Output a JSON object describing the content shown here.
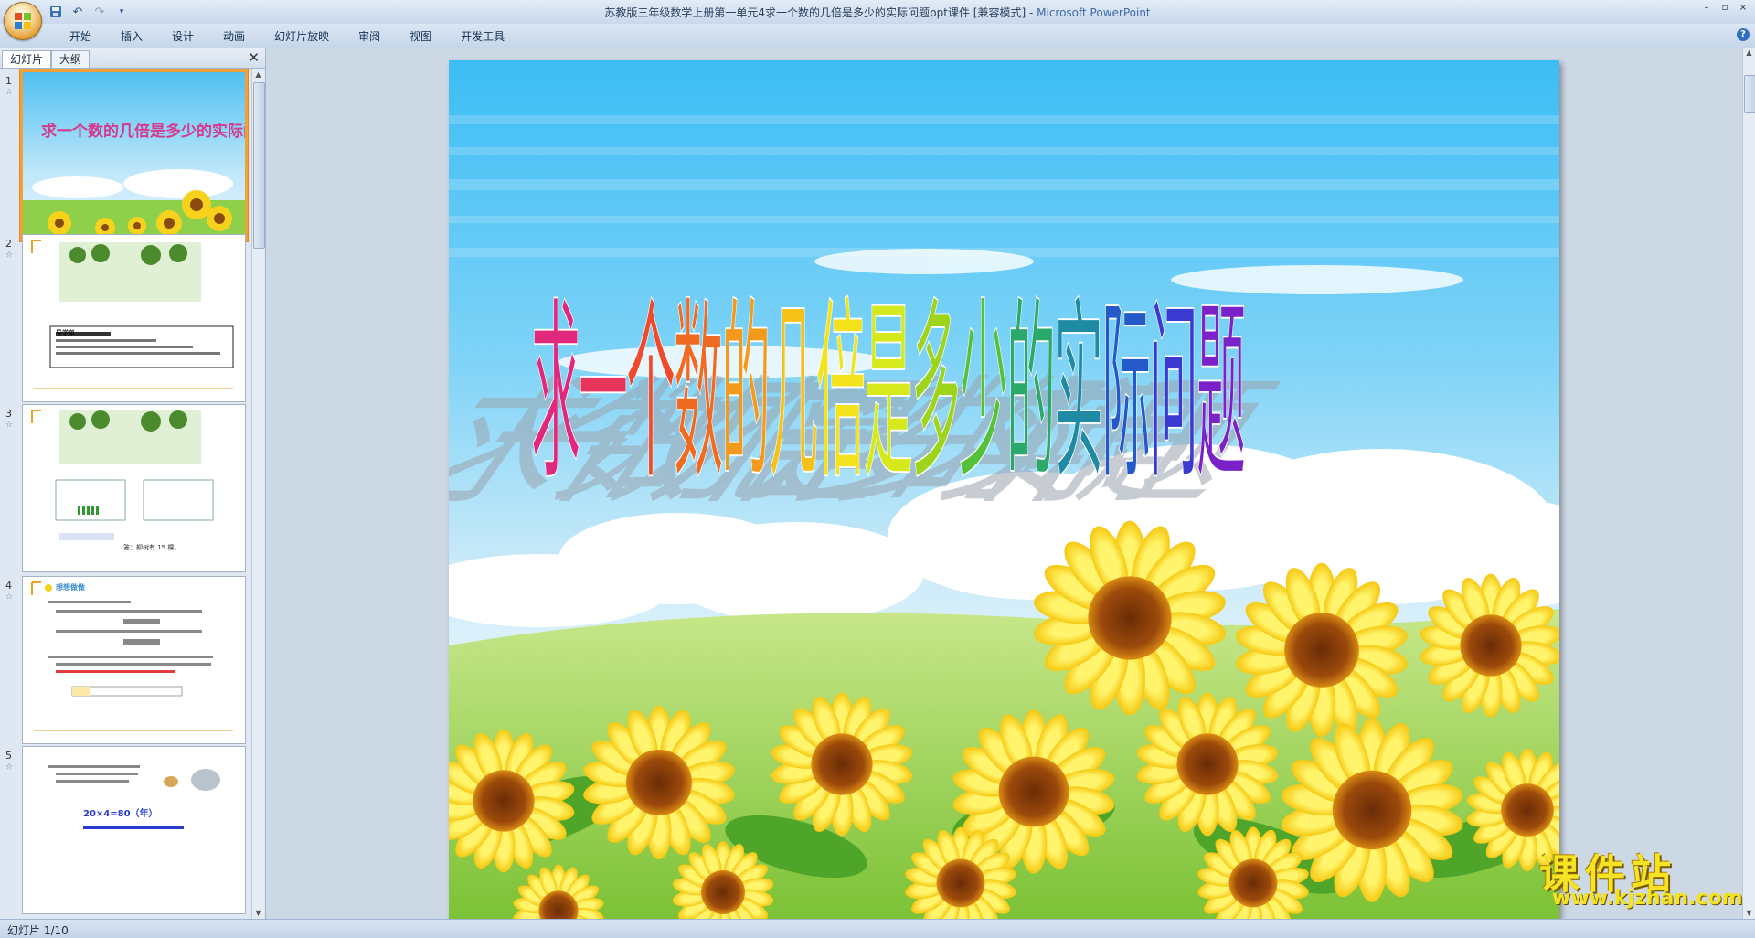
{
  "window": {
    "title": "苏教版三年级数学上册第一单元4求一个数的几倍是多少的实际问题ppt课件 [兼容模式]",
    "app_name": "Microsoft PowerPoint",
    "controls": [
      "–",
      "▫",
      "×"
    ]
  },
  "quick_access": [
    "save-icon",
    "undo-icon",
    "redo-icon",
    "customize-icon"
  ],
  "ribbon": {
    "tabs": [
      "开始",
      "插入",
      "设计",
      "动画",
      "幻灯片放映",
      "审阅",
      "视图",
      "开发工具"
    ]
  },
  "left_pane": {
    "tabs": [
      "幻灯片",
      "大纲"
    ],
    "thumbnails": [
      {
        "number": "1",
        "title": "求一个数的几倍是多少的实际问题"
      },
      {
        "number": "2",
        "title": "导学单"
      },
      {
        "number": "3",
        "title": "答：柳树有 15 棵。"
      },
      {
        "number": "4",
        "title": "想想做做"
      },
      {
        "number": "5",
        "title": "20×4=80（年）"
      }
    ]
  },
  "slide": {
    "title_chars": [
      "求",
      "一",
      "个",
      "数",
      "的",
      "几",
      "倍",
      "是",
      "多",
      "少",
      "的",
      "实",
      "际",
      "问",
      "题"
    ],
    "title_colors": [
      "#e0287c",
      "#e8335a",
      "#ef4a2c",
      "#f06a22",
      "#f39a1c",
      "#f6c21a",
      "#f3e21c",
      "#d6e91c",
      "#9fd41c",
      "#55c03a",
      "#2aa96a",
      "#1f8aa3",
      "#2459c8",
      "#3a39d0",
      "#7a22c8"
    ]
  },
  "status": {
    "slide_label": "幻灯片 1/10"
  },
  "watermark": {
    "title": "课件站",
    "url": "www.kjzhan.com"
  }
}
